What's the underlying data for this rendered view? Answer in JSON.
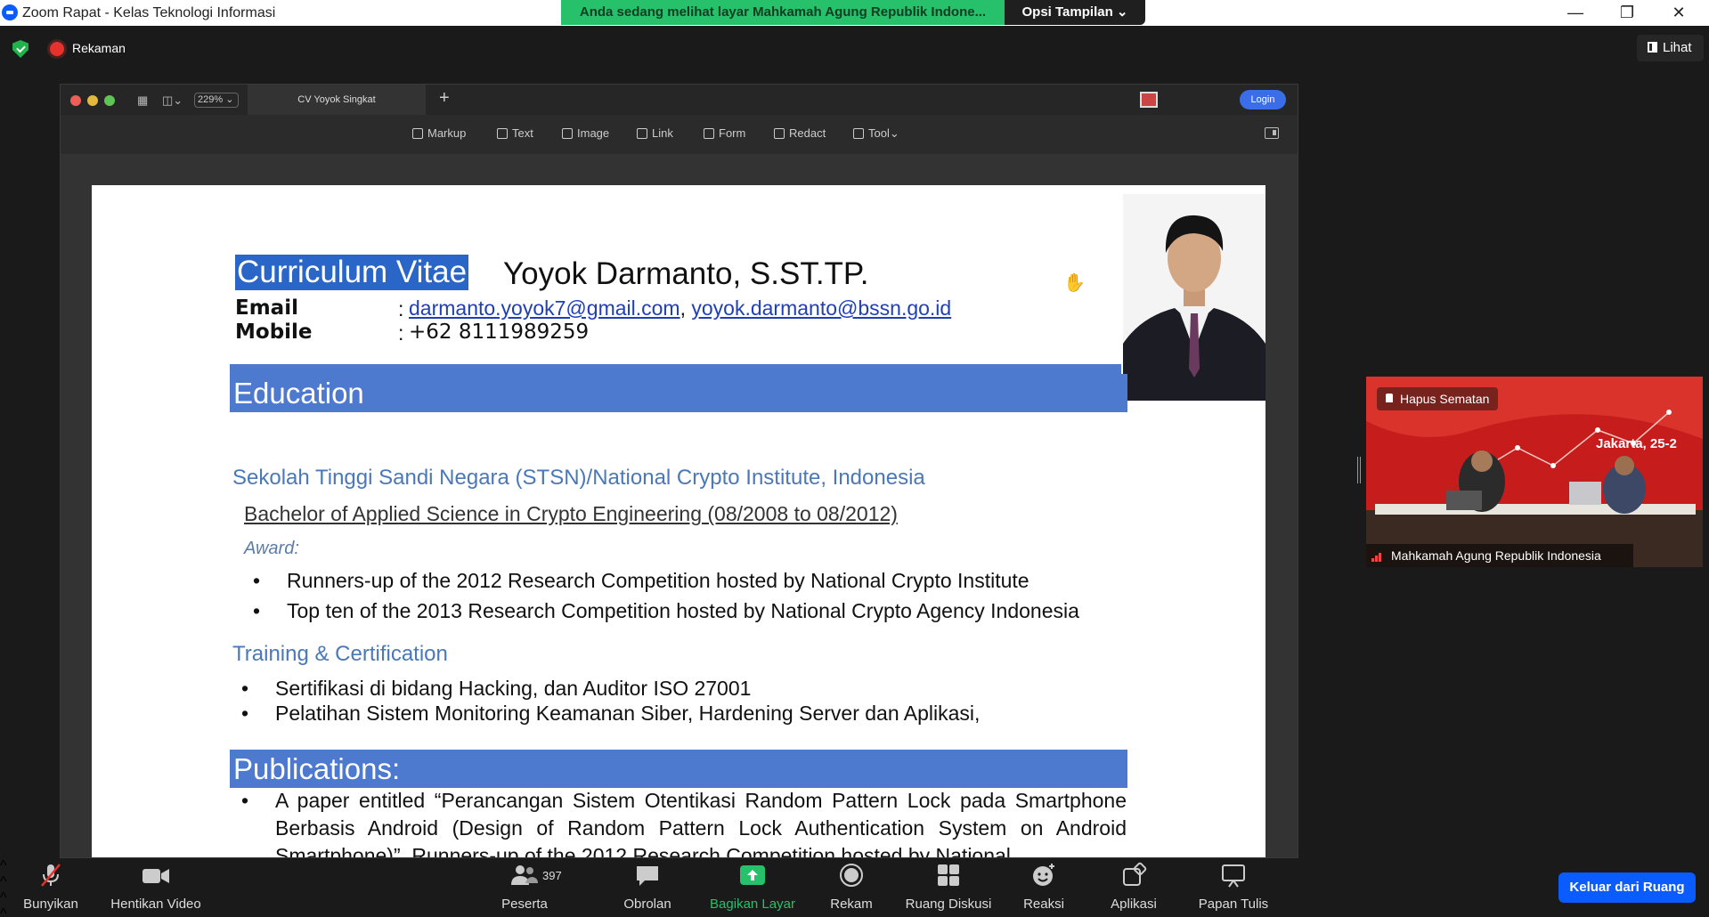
{
  "window": {
    "title": "Zoom Rapat - Kelas Teknologi Informasi",
    "min": "—",
    "max": "❐",
    "close": "✕"
  },
  "banner": {
    "viewing_text": "Anda sedang melihat layar Mahkamah Agung Republik Indone...",
    "view_options": "Opsi Tampilan ⌄"
  },
  "topbar": {
    "recording_label": "Rekaman",
    "view_label": "Lihat"
  },
  "shared_app": {
    "zoom_level": "229%",
    "tab_title": "CV Yoyok Singkat",
    "new_tab": "+",
    "login_label": "Login",
    "tools": [
      {
        "label": "Markup",
        "icon": "pen-icon"
      },
      {
        "label": "Text",
        "icon": "text-icon"
      },
      {
        "label": "Image",
        "icon": "image-icon"
      },
      {
        "label": "Link",
        "icon": "link-icon"
      },
      {
        "label": "Form",
        "icon": "form-icon"
      },
      {
        "label": "Redact",
        "icon": "redact-icon"
      },
      {
        "label": "Tool",
        "icon": "tool-icon"
      }
    ]
  },
  "document": {
    "cv_heading": "Curriculum Vitae",
    "name": "Yoyok Darmanto, S.ST.TP.",
    "email_label": "Email",
    "mobile_label": "Mobile",
    "colon": ":",
    "email_1": "darmanto.yoyok7@gmail.com",
    "email_sep": ",",
    "email_2": "yoyok.darmanto@bssn.go.id",
    "mobile": "+62 8111989259",
    "education_heading": "Education",
    "school": "Sekolah Tinggi Sandi Negara (STSN)/National Crypto Institute, Indonesia",
    "degree": "Bachelor of Applied Science in Crypto Engineering (08/2008 to 08/2012)",
    "award_label": "Award:",
    "awards": [
      "Runners-up of the 2012 Research Competition hosted by National Crypto Institute",
      "Top ten of the 2013 Research Competition hosted by National Crypto Agency Indonesia"
    ],
    "training_heading": "Training & Certification",
    "trainings": [
      "Sertifikasi di bidang Hacking, dan Auditor ISO 27001",
      "Pelatihan Sistem Monitoring Keamanan Siber, Hardening Server dan Aplikasi,"
    ],
    "publications_heading": "Publications:",
    "publication_1": "A paper entitled “Perancangan Sistem Otentikasi Random Pattern Lock pada Smartphone Berbasis Android (Design of Random Pattern Lock Authentication System on Android Smartphone)”, Runners-up of the 2012 Research Competition hosted by National",
    "bullet": "•"
  },
  "video": {
    "unpin_label": "Hapus Sematan",
    "participant_name": "Mahkamah Agung Republik Indonesia",
    "banner_text": "Jakarta, 25-2"
  },
  "bottombar": {
    "mute": "Bunyikan",
    "stop_video": "Hentikan Video",
    "participants": "Peserta",
    "participant_count": "397",
    "chat": "Obrolan",
    "share": "Bagikan Layar",
    "record": "Rekam",
    "breakout": "Ruang Diskusi",
    "reactions": "Reaksi",
    "apps": "Aplikasi",
    "whiteboard": "Papan Tulis",
    "leave": "Keluar dari Ruang"
  },
  "colors": {
    "accent": "#0b5cff",
    "share_green": "#26c16a",
    "section_blue": "#4d79cf",
    "record_red": "#e5322d"
  }
}
